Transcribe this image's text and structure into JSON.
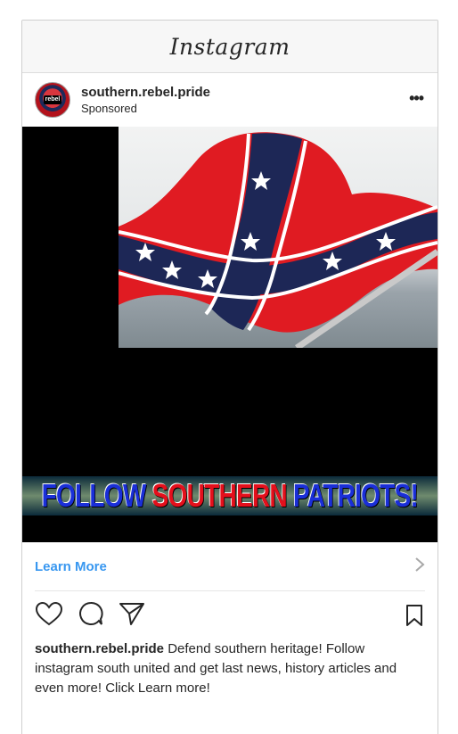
{
  "app": {
    "title": "Instagram"
  },
  "post": {
    "username": "southern.rebel.pride",
    "label": "Sponsored",
    "avatar_text": "rebel",
    "banner": {
      "part1": "FOLLOW ",
      "part2": "SOUTHERN ",
      "part3": "PATRIOTS!"
    },
    "cta_label": "Learn More",
    "caption_user": "southern.rebel.pride",
    "caption_text": "Defend southern heritage! Follow instagram south united and get last news, history articles and even more! Click Learn more!"
  },
  "colors": {
    "link_blue": "#3897f0",
    "flag_red": "#e4101c",
    "flag_blue": "#1a2fd8"
  },
  "icons": [
    "more-icon",
    "heart-icon",
    "comment-icon",
    "share-icon",
    "bookmark-icon",
    "chevron-right-icon"
  ]
}
